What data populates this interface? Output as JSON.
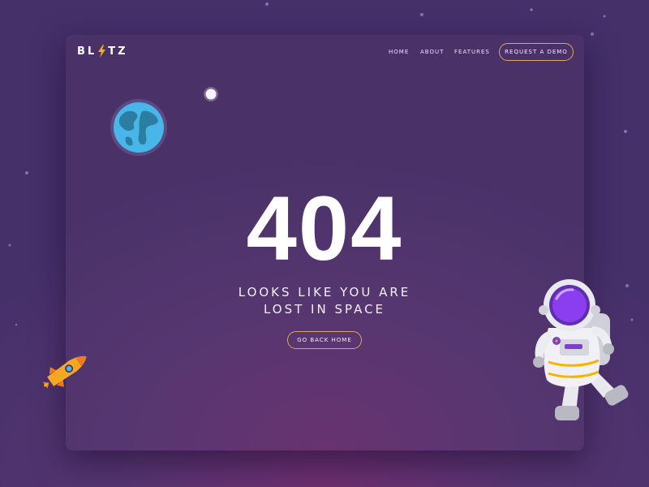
{
  "brand": {
    "logo_left": "BL",
    "logo_right": "TZ",
    "logo_icon": "lightning-bolt-icon",
    "bolt_color": "#f5b400"
  },
  "nav": {
    "items": [
      {
        "label": "HOME"
      },
      {
        "label": "ABOUT"
      },
      {
        "label": "FEATURES"
      }
    ],
    "cta_label": "REQUEST A DEMO"
  },
  "error": {
    "code": "404",
    "line1": "LOOKS LIKE YOU ARE",
    "line2": "LOST IN SPACE",
    "button_label": "GO BACK HOME"
  },
  "illustrations": {
    "planet": "earth-icon",
    "moon": "moon-icon",
    "rocket": "rocket-icon",
    "astronaut": "astronaut-icon"
  },
  "colors": {
    "background": "#4a3269",
    "accent_border": "#d9a75f",
    "text": "#ffffff"
  }
}
